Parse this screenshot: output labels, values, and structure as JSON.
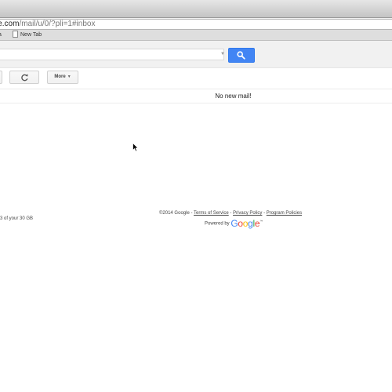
{
  "browser": {
    "url_domain": "le.com",
    "url_path": "/mail/u/0/?pli=1#inbox",
    "bookmarks": {
      "first_partial": "a",
      "new_tab": "New Tab"
    }
  },
  "search": {
    "value": "",
    "placeholder": "",
    "button_icon": "search-icon",
    "dropdown_icon": "caret-down-icon"
  },
  "toolbar": {
    "refresh_icon": "refresh-icon",
    "more_label": "More",
    "more_arrow": "▼"
  },
  "message_list": {
    "empty_text": "No new mail!"
  },
  "footer": {
    "storage_partial": "3 of your 30 GB",
    "copyright": "©2014 Google",
    "sep1": " - ",
    "terms": "Terms of Service",
    "sep2": " - ",
    "privacy": "Privacy Policy",
    "sep3": " - ",
    "policies": "Program Policies",
    "powered_by": "Powered by",
    "google_logo": "Google",
    "trademark": "™"
  },
  "colors": {
    "search_button": "#4285f4",
    "logo_blue": "#4285f4",
    "logo_red": "#ea4335",
    "logo_yellow": "#fbbc05",
    "logo_green": "#34a853"
  }
}
